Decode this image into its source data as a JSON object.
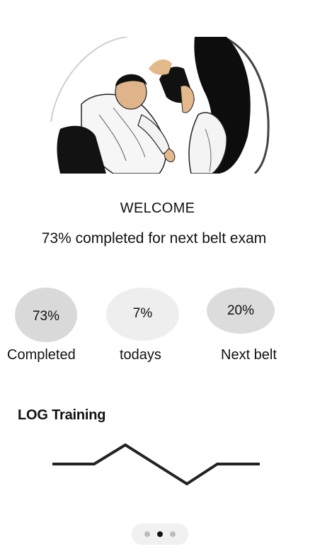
{
  "hero": {
    "image": "judo-throw-illustration"
  },
  "welcome": {
    "title": "WELCOME",
    "subtitle": "73% completed for next belt exam"
  },
  "stats": [
    {
      "value": "73%",
      "label": "Completed"
    },
    {
      "value": "7%",
      "label": "todays"
    },
    {
      "value": "20%",
      "label": "Next belt"
    }
  ],
  "log": {
    "title": "LOG Training"
  },
  "pager": {
    "count": 3,
    "active_index": 1
  }
}
